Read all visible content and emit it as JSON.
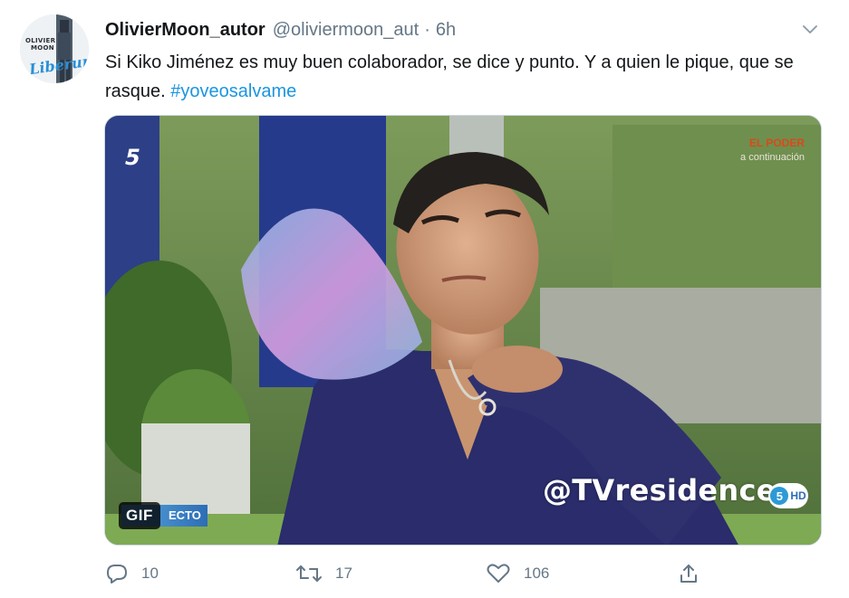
{
  "author": {
    "display_name": "OlivierMoon_autor",
    "handle": "@oliviermoon_aut",
    "separator": "·",
    "timestamp": "6h",
    "avatar_icon": "author-avatar",
    "avatar_text_line1": "OLIVIER",
    "avatar_text_line2": "MOON",
    "avatar_script": "Liberum"
  },
  "tweet": {
    "text_before_hashtag": "Si Kiko Jiménez es muy buen colaborador, se dice y punto. Y a quien le pique, que se rasque. ",
    "hashtag": "#yoveosalvame",
    "hashtag_color": "#1b95e0"
  },
  "media": {
    "type_badge": "GIF",
    "channel_logo": "5",
    "promo_line1": "EL PODER",
    "promo_line2": "a continuación",
    "watermark": "@TVresidence",
    "live_label": "ECTO",
    "hd_logo_number": "5",
    "hd_logo_text": "HD"
  },
  "actions": {
    "reply": {
      "icon": "reply-icon",
      "count": "10"
    },
    "retweet": {
      "icon": "retweet-icon",
      "count": "17"
    },
    "like": {
      "icon": "heart-icon",
      "count": "106"
    },
    "share": {
      "icon": "share-icon"
    }
  },
  "menu": {
    "icon": "chevron-down-icon"
  },
  "colors": {
    "secondary_text": "#657786",
    "primary_text": "#14171a",
    "link": "#1b95e0"
  }
}
